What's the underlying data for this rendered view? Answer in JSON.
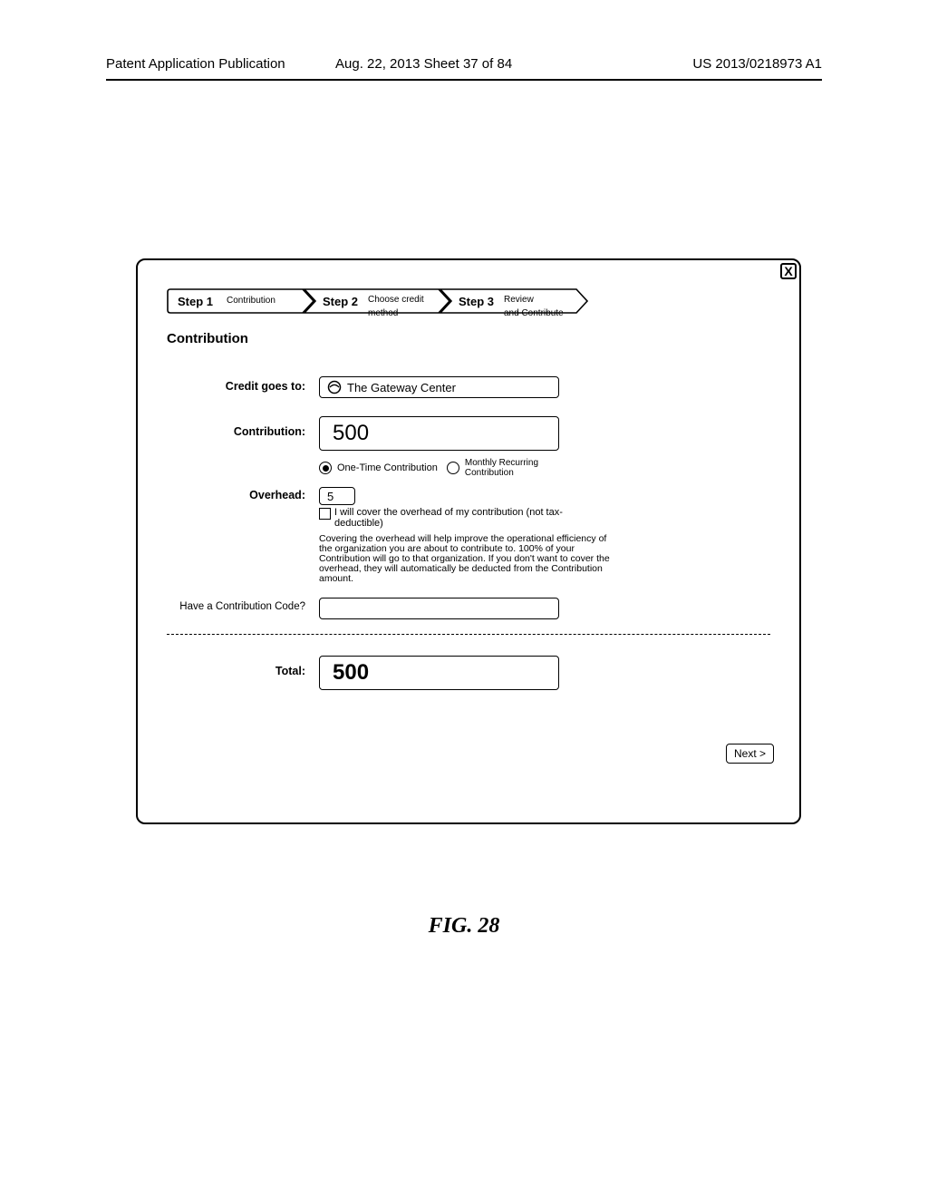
{
  "header": {
    "left": "Patent Application Publication",
    "center": "Aug. 22, 2013  Sheet 37 of 84",
    "right": "US 2013/0218973 A1"
  },
  "close_label": "X",
  "steps": {
    "s1_title": "Step 1",
    "s1_sub": "Contribution",
    "s2_title": "Step 2",
    "s2_sub1": "Choose credit",
    "s2_sub2": "method",
    "s3_title": "Step 3",
    "s3_sub1": "Review",
    "s3_sub2": "and Contribute"
  },
  "section_title": "Contribution",
  "labels": {
    "credit_to": "Credit goes to:",
    "contribution": "Contribution:",
    "overhead": "Overhead:",
    "code": "Have a Contribution Code?",
    "total": "Total:"
  },
  "values": {
    "credit_to": "The Gateway Center",
    "contribution": "500",
    "overhead": "5",
    "code": "",
    "total": "500"
  },
  "radios": {
    "one_time": "One-Time Contribution",
    "monthly1": "Monthly Recurring",
    "monthly2": "Contribution"
  },
  "checkbox_label": "I will cover the overhead of my contribution (not tax-deductible)",
  "overhead_note": "Covering the overhead will help improve the operational efficiency of the organization you are about to contribute to. 100% of your Contribution will go to that organization. If you don't want to cover the overhead, they will automatically be deducted from the Contribution amount.",
  "next_label": "Next >",
  "figure_caption": "FIG. 28"
}
